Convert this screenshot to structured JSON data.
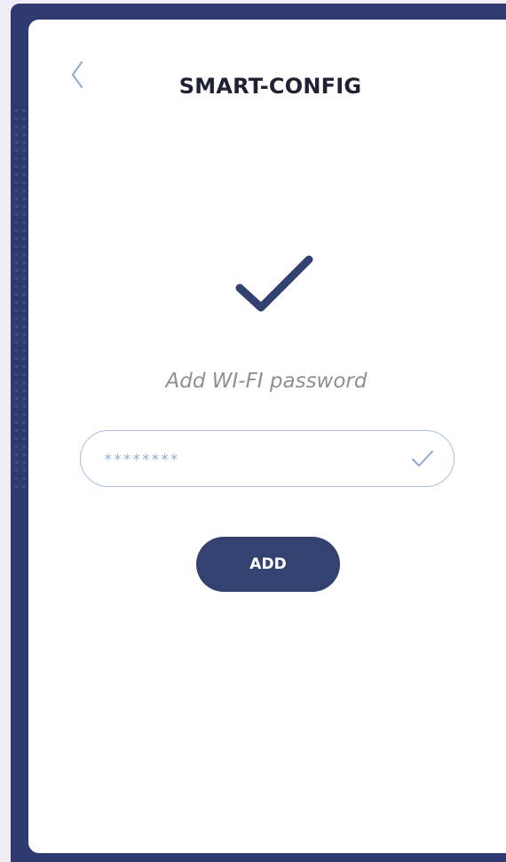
{
  "header": {
    "title": "SMART-CONFIG",
    "back_icon": "chevron-left-icon"
  },
  "status": {
    "icon": "checkmark-icon",
    "prompt": "Add WI-FI password"
  },
  "password_field": {
    "value": "********",
    "placeholder": "",
    "check_icon": "checkmark-icon"
  },
  "actions": {
    "add_label": "ADD"
  },
  "colors": {
    "frame": "#2f3b70",
    "card": "#ffffff",
    "primary": "#344272",
    "field_border": "#a8bfe4",
    "title_text": "#1e2233",
    "muted_text": "#8e8e96"
  }
}
